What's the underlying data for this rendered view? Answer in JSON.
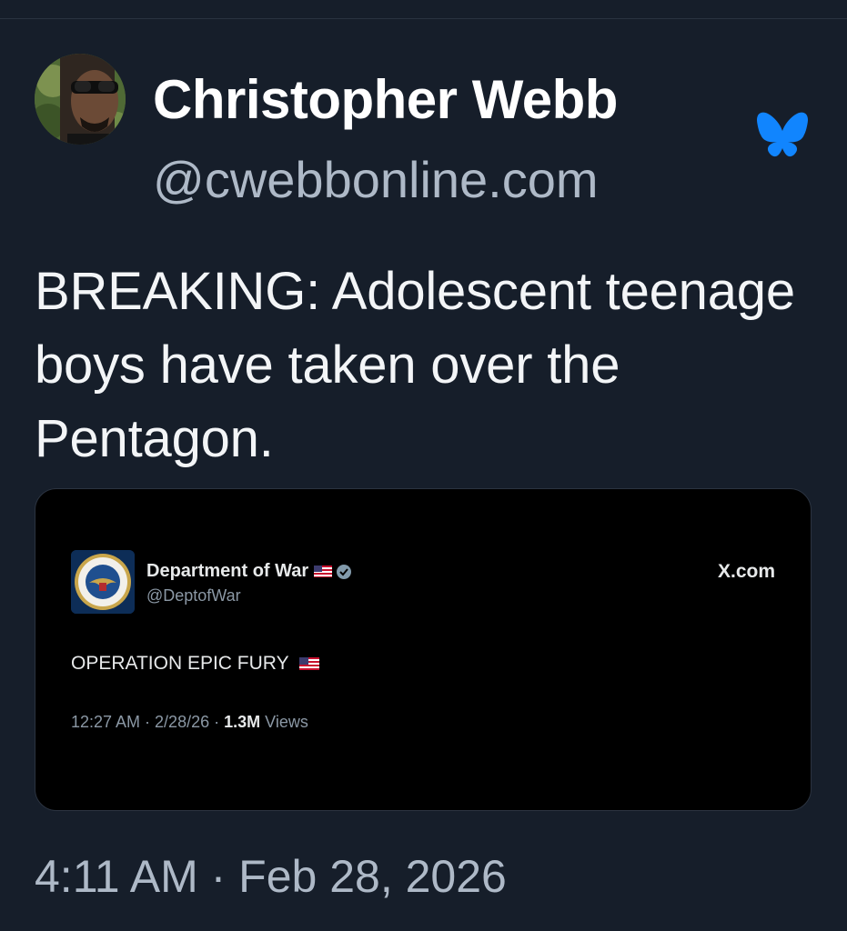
{
  "post": {
    "author_name": "Christopher Webb",
    "author_handle": "@cwebbonline.com",
    "text": "BREAKING: Adolescent teenage boys have taken over the Pentagon.",
    "timestamp": "4:11 AM · Feb 28, 2026",
    "platform_icon": "butterfly-icon",
    "accent_color": "#1185fe"
  },
  "embed": {
    "account_name": "Department of War",
    "account_handle": "@DeptofWar",
    "source": "X.com",
    "text": "OPERATION EPIC FURY",
    "time": "12:27 AM · 2/28/26 ·",
    "views_count": "1.3M",
    "views_label": "Views",
    "icons": [
      "us-flag-icon",
      "verified-badge-icon",
      "department-seal-icon"
    ]
  }
}
